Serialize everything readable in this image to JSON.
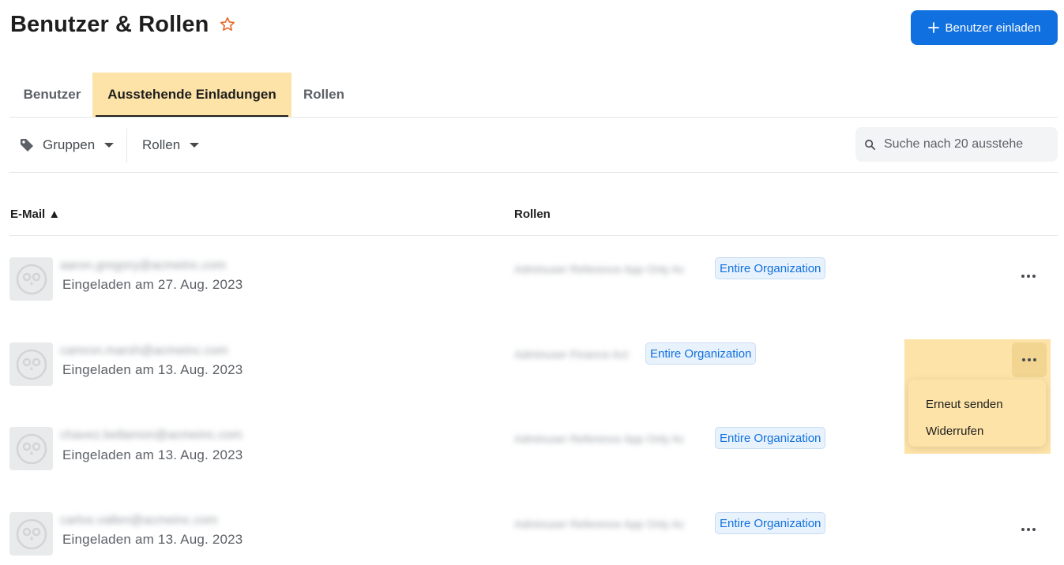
{
  "page": {
    "title": "Benutzer & Rollen",
    "invite_button_label": "Benutzer einladen"
  },
  "tabs": [
    {
      "label": "Benutzer",
      "active": false
    },
    {
      "label": "Ausstehende Einladungen",
      "active": true
    },
    {
      "label": "Rollen",
      "active": false
    }
  ],
  "filters": {
    "groups_label": "Gruppen",
    "roles_label": "Rollen",
    "search_placeholder": "Suche nach 20 ausstehe"
  },
  "table": {
    "columns": {
      "email": "E-Mail ▲",
      "roles": "Rollen"
    },
    "rows": [
      {
        "email": "aaron.gregory@acmeinc.com",
        "invited": "Eingeladen am 27. Aug. 2023",
        "roles": "Adminuser Reference App Only Ac",
        "badge": "Entire Organization"
      },
      {
        "email": "camron.marsh@acmeinc.com",
        "invited": "Eingeladen am 13. Aug. 2023",
        "roles": "Adminuser Finance Act",
        "badge": "Entire Organization"
      },
      {
        "email": "chavez.bellamon@acmeinc.com",
        "invited": "Eingeladen am 13. Aug. 2023",
        "roles": "Adminuser Reference App Only Ac",
        "badge": "Entire Organization"
      },
      {
        "email": "carlos.vallen@acmeinc.com",
        "invited": "Eingeladen am 13. Aug. 2023",
        "roles": "Adminuser Reference App Only Ac",
        "badge": "Entire Organization"
      }
    ]
  },
  "row_menu": {
    "resend": "Erneut senden",
    "revoke": "Widerrufen"
  },
  "colors": {
    "accent": "#1170e0",
    "highlight": "#fde3a7",
    "star": "#e8692a"
  }
}
